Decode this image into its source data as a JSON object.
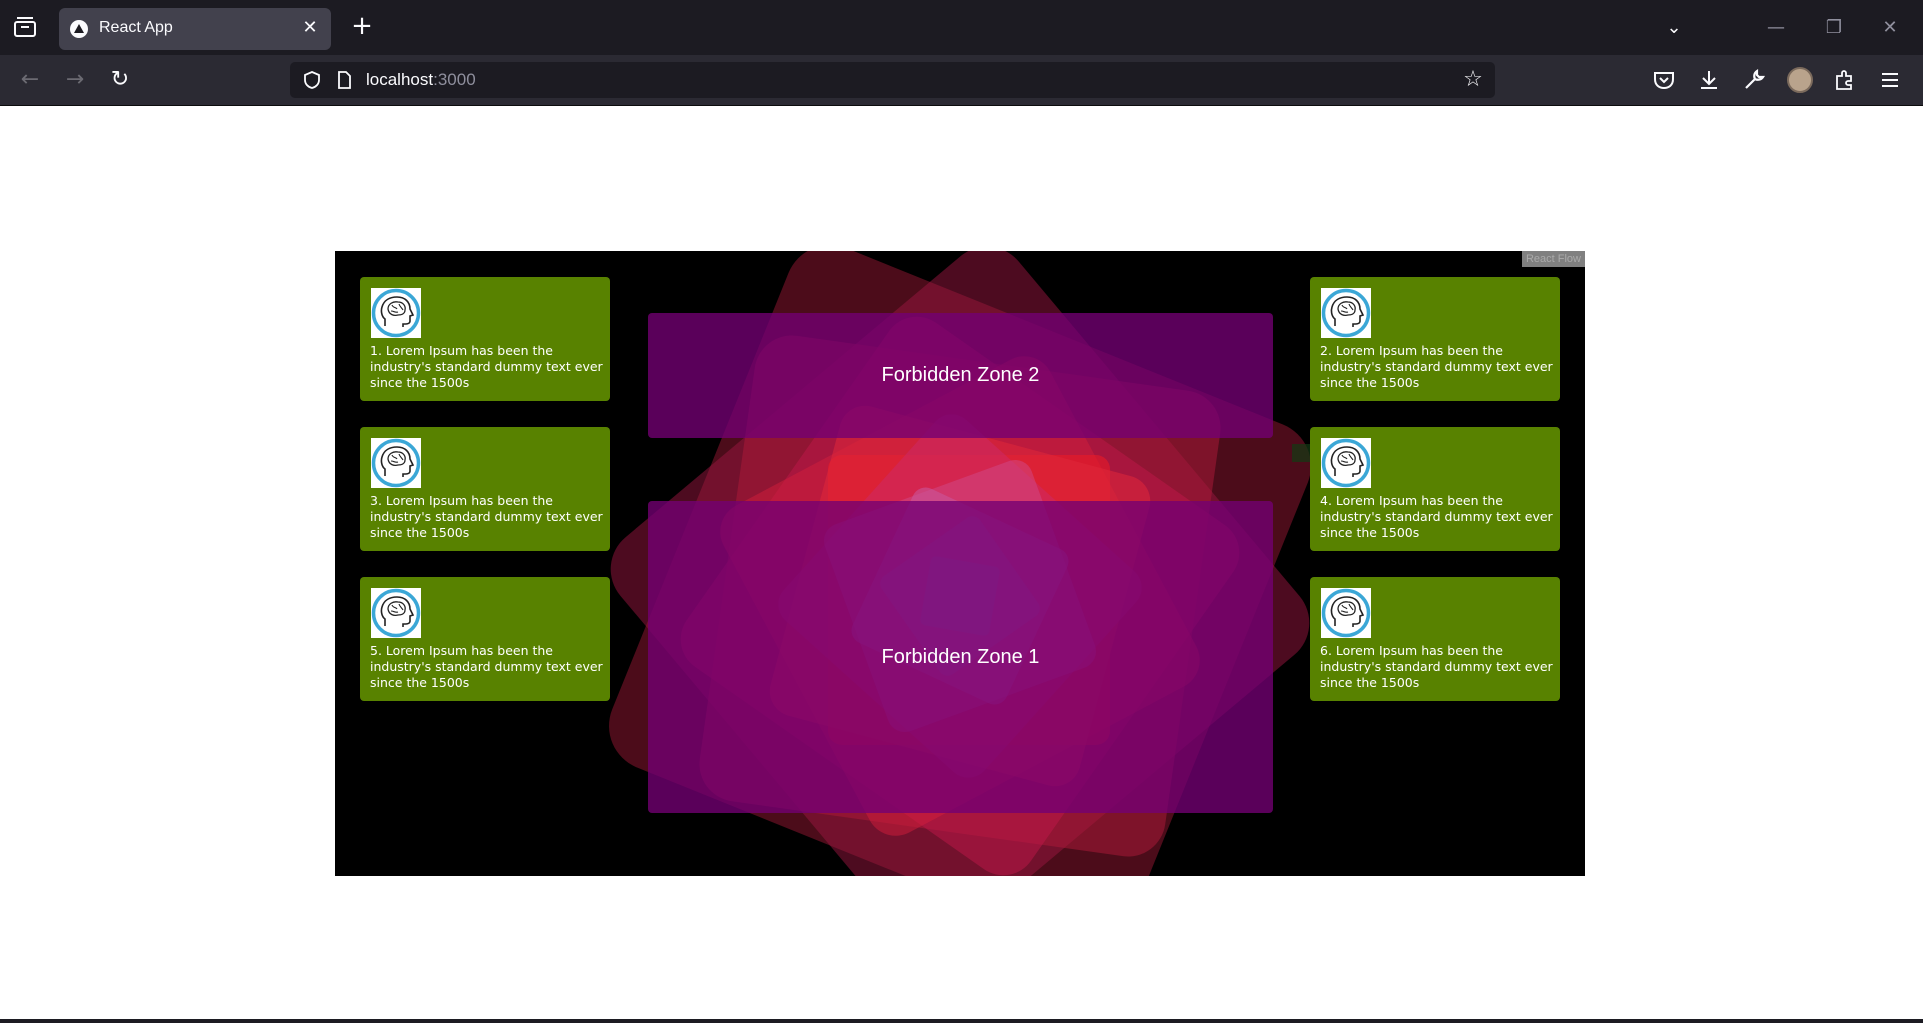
{
  "browser": {
    "tab_title": "React App",
    "url_host": "localhost",
    "url_port": ":3000"
  },
  "flow": {
    "attribution": "React Flow",
    "zones": [
      {
        "label": "Forbidden Zone 2"
      },
      {
        "label": "Forbidden Zone 1"
      }
    ],
    "cards": [
      {
        "text": "1. Lorem Ipsum has been the industry's standard dummy text ever since the 1500s"
      },
      {
        "text": "2. Lorem Ipsum has been the industry's standard dummy text ever since the 1500s"
      },
      {
        "text": "3. Lorem Ipsum has been the industry's standard dummy text ever since the 1500s"
      },
      {
        "text": "4. Lorem Ipsum has been the industry's standard dummy text ever since the 1500s"
      },
      {
        "text": "5. Lorem Ipsum has been the industry's standard dummy text ever since the 1500s"
      },
      {
        "text": "6. Lorem Ipsum has been the industry's standard dummy text ever since the 1500s"
      }
    ]
  },
  "colors": {
    "card": "#588200",
    "zone": "#730073",
    "canvas": "#000000"
  },
  "icons": [
    "tabs-menu-icon",
    "firefox-logo-icon",
    "close-icon",
    "plus-icon",
    "chevron-down-icon",
    "minimize-icon",
    "restore-icon",
    "window-close-icon",
    "back-icon",
    "forward-icon",
    "reload-icon",
    "shield-icon",
    "page-icon",
    "star-icon",
    "pocket-icon",
    "download-icon",
    "wrench-icon",
    "account-icon",
    "extensions-icon",
    "hamburger-menu-icon",
    "brain-head-icon"
  ]
}
